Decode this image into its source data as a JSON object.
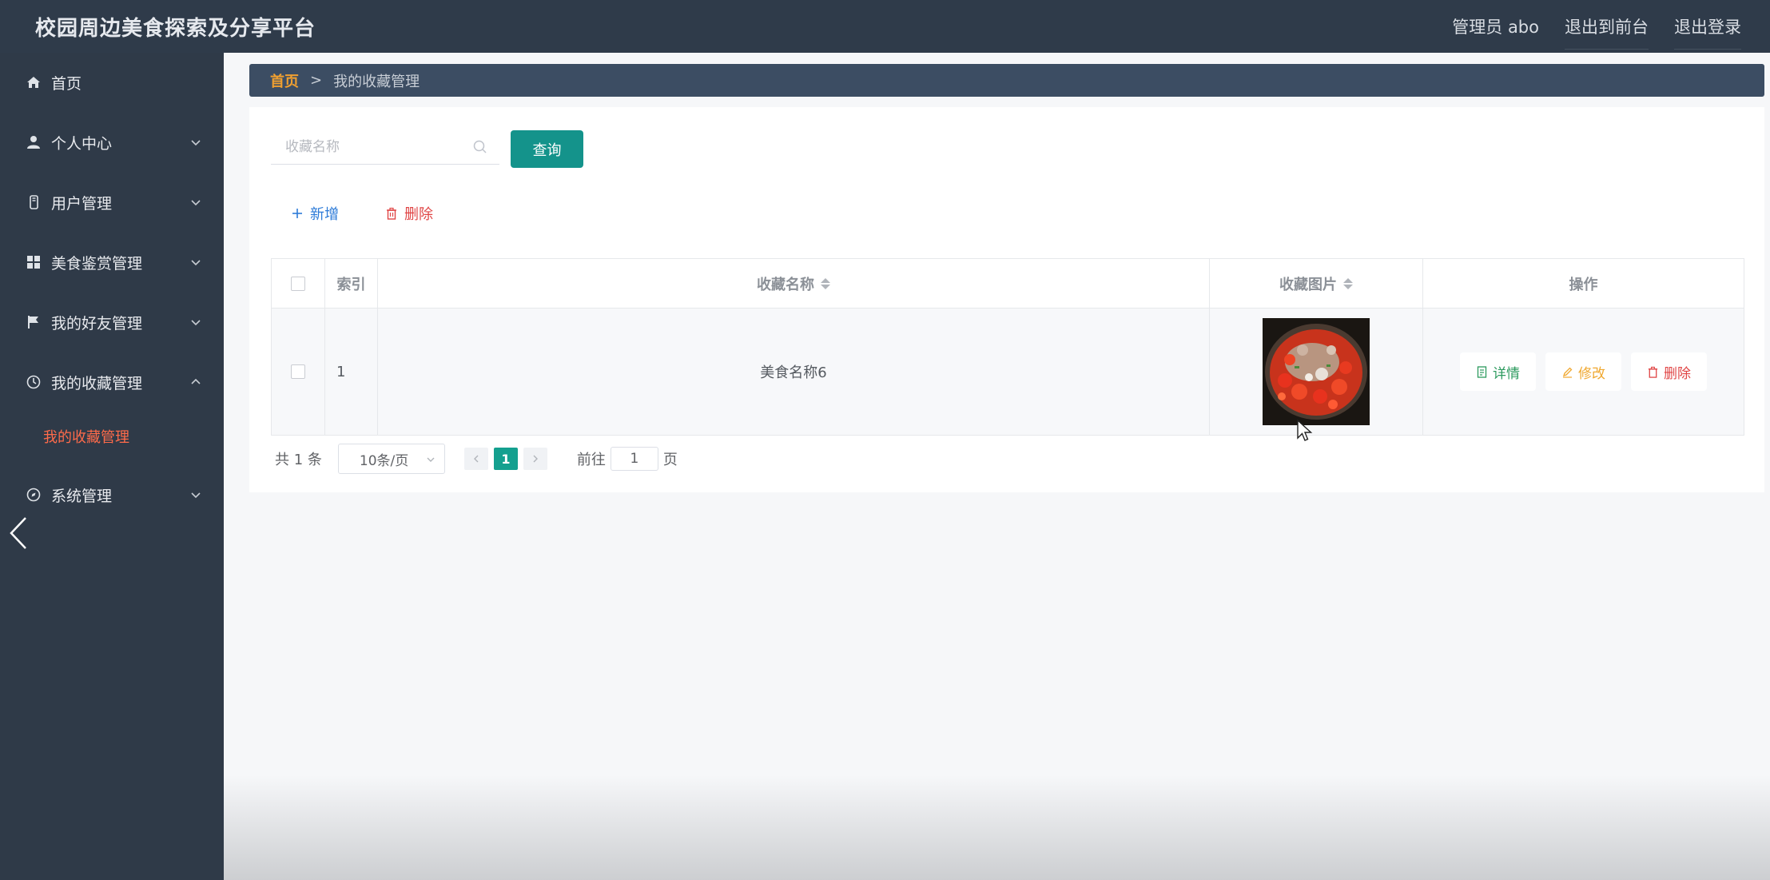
{
  "app": {
    "title": "校园周边美食探索及分享平台",
    "user_label": "管理员 abo",
    "to_frontend": "退出到前台",
    "logout": "退出登录"
  },
  "sidebar": {
    "items": [
      {
        "label": "首页",
        "icon": "home-icon"
      },
      {
        "label": "个人中心",
        "icon": "user-icon"
      },
      {
        "label": "用户管理",
        "icon": "phone-icon"
      },
      {
        "label": "美食鉴赏管理",
        "icon": "grid-icon"
      },
      {
        "label": "我的好友管理",
        "icon": "flag-icon"
      },
      {
        "label": "我的收藏管理",
        "icon": "clock-icon"
      },
      {
        "label": "系统管理",
        "icon": "compass-icon"
      }
    ],
    "active_sub": "我的收藏管理"
  },
  "breadcrumb": {
    "home": "首页",
    "separator": ">",
    "current": "我的收藏管理"
  },
  "search": {
    "placeholder": "收藏名称",
    "value": "",
    "query_button": "查询"
  },
  "actions": {
    "add": "新增",
    "delete": "删除"
  },
  "table": {
    "headers": {
      "index": "索引",
      "name": "收藏名称",
      "image": "收藏图片",
      "ops": "操作"
    },
    "rows": [
      {
        "index": "1",
        "name": "美食名称6",
        "image": "tomato-stew-photo"
      }
    ],
    "op_labels": {
      "detail": "详情",
      "edit": "修改",
      "remove": "删除"
    }
  },
  "pagination": {
    "total_text": "共 1 条",
    "page_size": "10条/页",
    "current_page": "1",
    "goto_prefix": "前往",
    "goto_value": "1",
    "goto_suffix": "页"
  },
  "colors": {
    "topbar": "#2f3b4a",
    "sidebar": "#2f3a48",
    "accent_teal": "#14938b",
    "active_sub": "#ff6b4a",
    "crumb_home": "#f0a030"
  }
}
